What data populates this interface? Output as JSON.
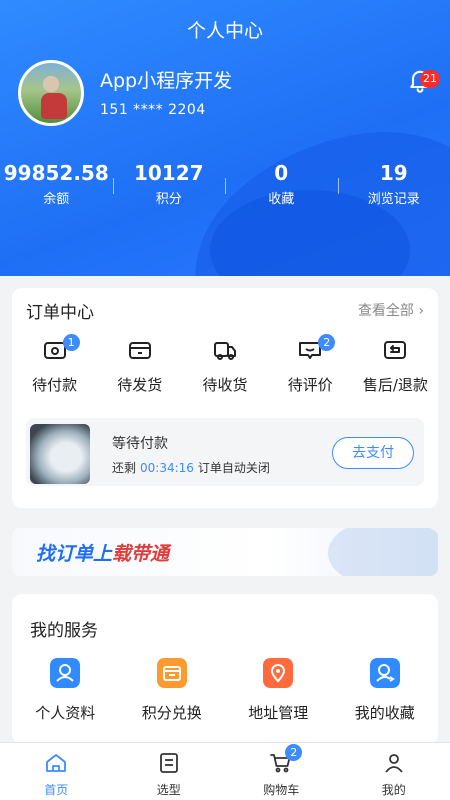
{
  "page_title": "个人中心",
  "user": {
    "name": "App小程序开发",
    "phone": "151 **** 2204",
    "notification_count": "21"
  },
  "stats": [
    {
      "value": "99852.58",
      "label": "余额"
    },
    {
      "value": "10127",
      "label": "积分"
    },
    {
      "value": "0",
      "label": "收藏"
    },
    {
      "value": "19",
      "label": "浏览记录"
    }
  ],
  "orders": {
    "title": "订单中心",
    "view_all": "查看全部 ›",
    "items": [
      {
        "label": "待付款",
        "badge": "1",
        "icon": "wallet-icon"
      },
      {
        "label": "待发货",
        "badge": "",
        "icon": "card-icon"
      },
      {
        "label": "待收货",
        "badge": "",
        "icon": "truck-icon"
      },
      {
        "label": "待评价",
        "badge": "2",
        "icon": "comment-icon"
      },
      {
        "label": "售后/退款",
        "badge": "",
        "icon": "return-icon"
      }
    ],
    "pending": {
      "title": "等待付款",
      "remain_prefix": "还剩",
      "countdown": "00:34:16",
      "remain_suffix": "订单自动关闭",
      "pay_button": "去支付"
    }
  },
  "banner": {
    "text_blue": "找订单上",
    "text_red": "载带通"
  },
  "services": {
    "title": "我的服务",
    "items": [
      {
        "label": "个人资料",
        "icon": "profile-icon",
        "color": "#2f8bff"
      },
      {
        "label": "积分兑换",
        "icon": "shop-icon",
        "color": "#ff9a2e"
      },
      {
        "label": "地址管理",
        "icon": "location-icon",
        "color": "#ff6b3d"
      },
      {
        "label": "我的收藏",
        "icon": "favorite-icon",
        "color": "#2f8bff"
      }
    ]
  },
  "tabbar": [
    {
      "label": "首页",
      "icon": "home-icon",
      "active": true
    },
    {
      "label": "选型",
      "icon": "list-icon",
      "active": false
    },
    {
      "label": "购物车",
      "icon": "cart-icon",
      "active": false,
      "badge": "2"
    },
    {
      "label": "我的",
      "icon": "user-icon",
      "active": false
    }
  ],
  "colors": {
    "primary": "#3d8bfd",
    "header": "#1f6ff5",
    "alert": "#ff2b2b",
    "banner_red": "#e23b3b"
  }
}
